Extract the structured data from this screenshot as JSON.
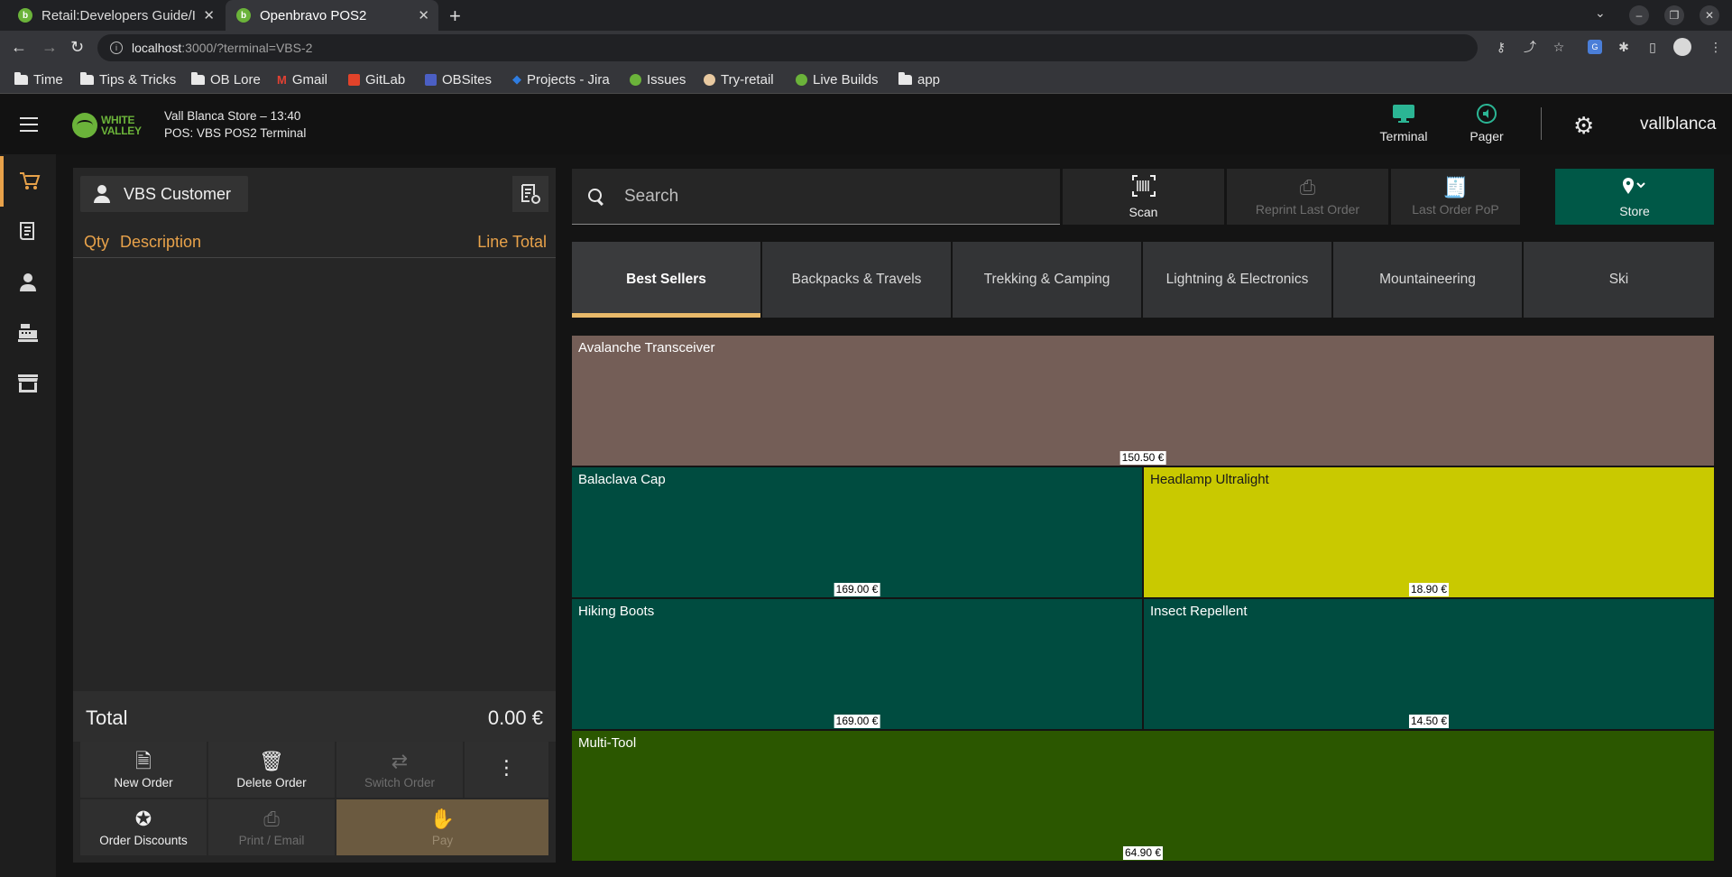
{
  "browser": {
    "tabs": [
      {
        "title": "Retail:Developers Guide/I",
        "active": false
      },
      {
        "title": "Openbravo POS2",
        "active": true
      }
    ],
    "url_host": "localhost",
    "url_path": ":3000/?terminal=VBS-2",
    "bookmarks": [
      {
        "label": "Time",
        "icon": "folder-icon"
      },
      {
        "label": "Tips & Tricks",
        "icon": "folder-icon"
      },
      {
        "label": "OB Lore",
        "icon": "folder-icon"
      },
      {
        "label": "Gmail",
        "icon": "gmail-icon"
      },
      {
        "label": "GitLab",
        "icon": "gitlab-icon"
      },
      {
        "label": "OBSites",
        "icon": "obsites-icon"
      },
      {
        "label": "Projects - Jira",
        "icon": "jira-icon"
      },
      {
        "label": "Issues",
        "icon": "openbravo-icon"
      },
      {
        "label": "Try-retail",
        "icon": "try-retail-icon"
      },
      {
        "label": "Live Builds",
        "icon": "openbravo-icon"
      },
      {
        "label": "app",
        "icon": "folder-icon"
      }
    ]
  },
  "header": {
    "store_line": "Vall Blanca Store – 13:40",
    "terminal_line": "POS: VBS POS2 Terminal",
    "logo_line1": "WHITE",
    "logo_line2": "VALLEY",
    "terminal_label": "Terminal",
    "pager_label": "Pager",
    "username": "vallblanca"
  },
  "ticket": {
    "customer": "VBS Customer",
    "col_qty": "Qty",
    "col_desc": "Description",
    "col_total": "Line Total",
    "total_label": "Total",
    "total_value": "0.00 €",
    "actions": {
      "new_order": "New Order",
      "delete_order": "Delete Order",
      "switch_order": "Switch Order",
      "order_discounts": "Order Discounts",
      "print_email": "Print / Email",
      "pay": "Pay"
    }
  },
  "toolbar": {
    "search_placeholder": "Search",
    "scan": "Scan",
    "reprint": "Reprint Last Order",
    "last_order_pop": "Last Order PoP",
    "store": "Store"
  },
  "categories": [
    "Best Sellers",
    "Backpacks & Travels",
    "Trekking & Camping",
    "Lightning & Electronics",
    "Mountaineering",
    "Ski"
  ],
  "products": [
    {
      "name": "Avalanche Transceiver",
      "price": "150.50 €",
      "color": "#745e57"
    },
    {
      "name": "Balaclava Cap",
      "price": "169.00 €",
      "color": "#004c40"
    },
    {
      "name": "Headlamp Ultralight",
      "price": "18.90 €",
      "color": "#c9c900"
    },
    {
      "name": "Hiking Boots",
      "price": "169.00 €",
      "color": "#004c40"
    },
    {
      "name": "Insect Repellent",
      "price": "14.50 €",
      "color": "#004c40"
    },
    {
      "name": "Multi-Tool",
      "price": "64.90 €",
      "color": "#2b5700"
    }
  ],
  "colors": {
    "accent": "#e8a24a",
    "store_button": "#005847",
    "terminal_icon": "#2bb594"
  }
}
